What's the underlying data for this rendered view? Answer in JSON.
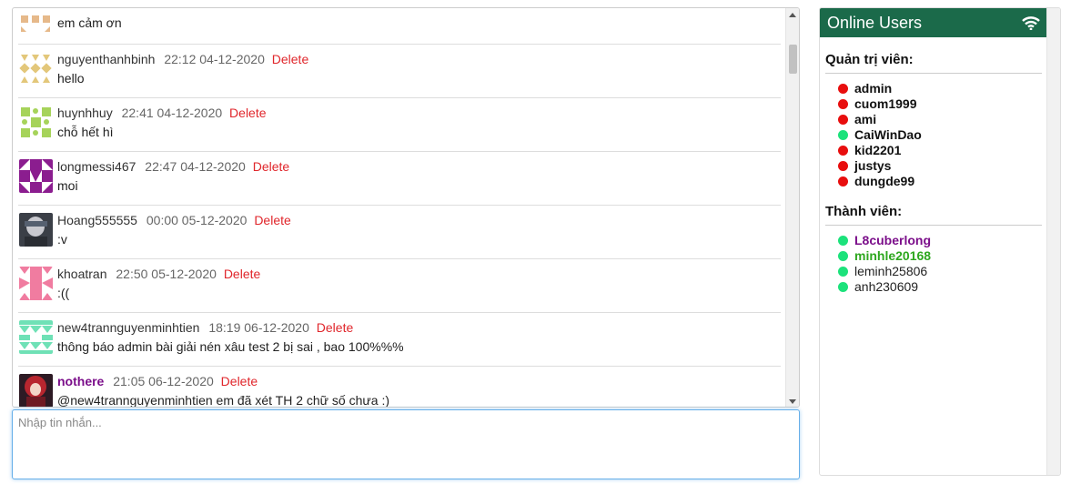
{
  "chat": {
    "messages": [
      {
        "user": "",
        "time": "",
        "delete": "",
        "text": "em cảm ơn",
        "avatar_color": "#e6b98a"
      },
      {
        "user": "nguyenthanhbinh",
        "time": "22:12 04-12-2020",
        "delete": "Delete",
        "text": "hello",
        "avatar_color": "#e3c77a"
      },
      {
        "user": "huynhhuy",
        "time": "22:41 04-12-2020",
        "delete": "Delete",
        "text": "chỗ hết hì",
        "avatar_color": "#a6d35a"
      },
      {
        "user": "longmessi467",
        "time": "22:47 04-12-2020",
        "delete": "Delete",
        "text": "moi",
        "avatar_color": "#8b1d8f"
      },
      {
        "user": "Hoang555555",
        "time": "00:00 05-12-2020",
        "delete": "Delete",
        "text": ":v",
        "avatar_color": "#4a4f58"
      },
      {
        "user": "khoatran",
        "time": "22:50 05-12-2020",
        "delete": "Delete",
        "text": ":((",
        "avatar_color": "#f07ca0"
      },
      {
        "user": "new4trannguyenminhtien",
        "time": "18:19 06-12-2020",
        "delete": "Delete",
        "text": "thông báo admin bài giải nén xâu test 2 bị sai , bao 100%%%",
        "avatar_color": "#6fe1b6"
      },
      {
        "user": "nothere",
        "time": "21:05 06-12-2020",
        "delete": "Delete",
        "text": "@new4trannguyenminhtien em đã xét TH 2 chữ số chưa :)",
        "avatar_color": "#b8262f"
      }
    ],
    "input_placeholder": "Nhập tin nhắn..."
  },
  "online": {
    "title": "Online Users",
    "admins_title": "Quản trị viên:",
    "admins": [
      {
        "name": "admin",
        "status": "red"
      },
      {
        "name": "cuom1999",
        "status": "red"
      },
      {
        "name": "ami",
        "status": "red"
      },
      {
        "name": "CaiWinDao",
        "status": "green"
      },
      {
        "name": "kid2201",
        "status": "red"
      },
      {
        "name": "justys",
        "status": "red"
      },
      {
        "name": "dungde99",
        "status": "red"
      }
    ],
    "members_title": "Thành viên:",
    "members": [
      {
        "name": "L8cuberlong",
        "status": "green",
        "style": "purple"
      },
      {
        "name": "minhle20168",
        "status": "green",
        "style": "green"
      },
      {
        "name": "leminh25806",
        "status": "green",
        "style": "normal"
      },
      {
        "name": "anh230609",
        "status": "green",
        "style": "normal"
      }
    ]
  },
  "colors": {
    "header_bg": "#1b6a4a",
    "delete": "#e0262b",
    "online_dot": "#1ce27b",
    "offline_dot": "#e80e0e"
  }
}
